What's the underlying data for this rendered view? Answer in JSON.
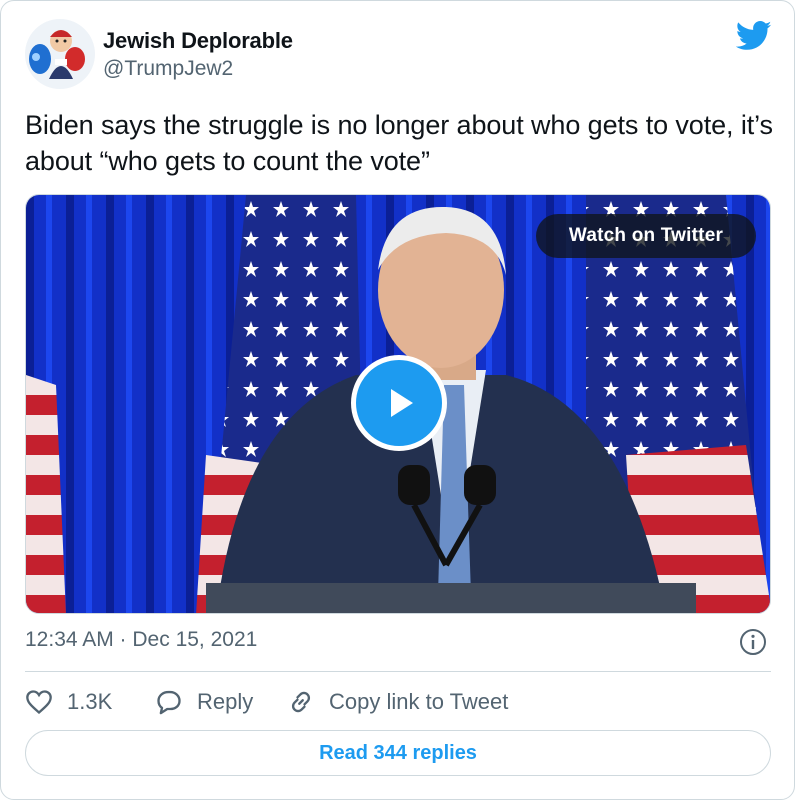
{
  "author": {
    "display_name": "Jewish Deplorable",
    "handle": "@TrumpJew2",
    "avatar_icon": "boxing-glove-cartoon-avatar"
  },
  "tweet": {
    "text": "Biden says the struggle is no longer about who gets to vote, it’s about “who gets to count the vote”"
  },
  "media": {
    "watch_label": "Watch on Twitter",
    "play_icon": "play-icon"
  },
  "meta": {
    "timestamp": "12:34 AM · Dec 15, 2021"
  },
  "actions": {
    "like_count": "1.3K",
    "reply_label": "Reply",
    "copy_label": "Copy link to Tweet"
  },
  "footer": {
    "read_replies_label": "Read 344 replies"
  },
  "colors": {
    "brand": "#1d9bf0",
    "secondary_text": "#536471",
    "border": "#cfd9de"
  }
}
